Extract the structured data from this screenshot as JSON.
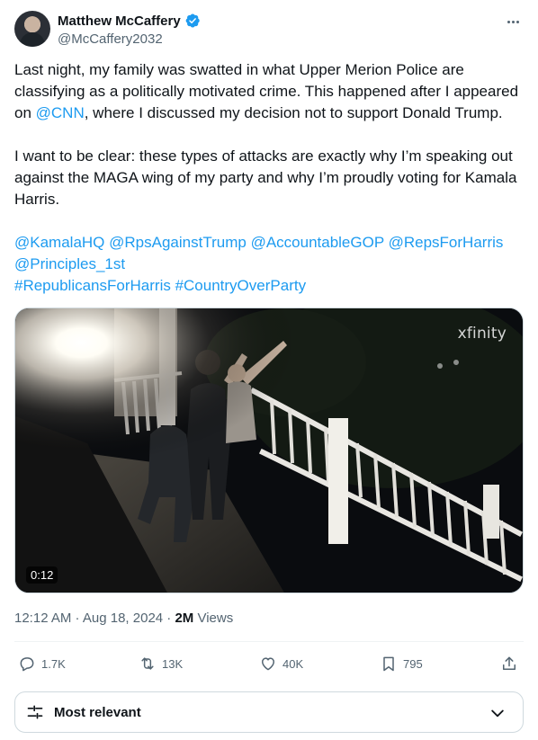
{
  "author": {
    "name": "Matthew McCaffery",
    "handle": "@McCaffery2032",
    "verified": true
  },
  "tweet": {
    "p1_a": "Last night, my family was swatted in what Upper Merion Police are classifying as a politically motivated crime. This happened after I appeared on ",
    "p1_mention": "@CNN",
    "p1_b": ", where I discussed my decision not to support Donald Trump.",
    "p2": "I want to be clear: these types of attacks are exactly why I’m speaking out against the MAGA wing of my party and why I’m proudly voting for Kamala Harris.",
    "mentions": [
      "@KamalaHQ",
      "@RpsAgainstTrump",
      "@AccountableGOP",
      "@RepsForHarris",
      "@Principles_1st"
    ],
    "hashtags": [
      "#RepublicansForHarris",
      "#CountryOverParty"
    ]
  },
  "media": {
    "watermark": "xfinity",
    "duration": "0:12"
  },
  "meta": {
    "timestamp": "12:12 AM · Aug 18, 2024 · ",
    "views_count": "2M",
    "views_label": " Views"
  },
  "actions": {
    "replies": "1.7K",
    "reposts": "13K",
    "likes": "40K",
    "bookmarks": "795"
  },
  "sort": {
    "label": "Most relevant"
  },
  "colors": {
    "link": "#1d9bf0",
    "verified": "#1d9bf0",
    "secondary_text": "#536471"
  }
}
